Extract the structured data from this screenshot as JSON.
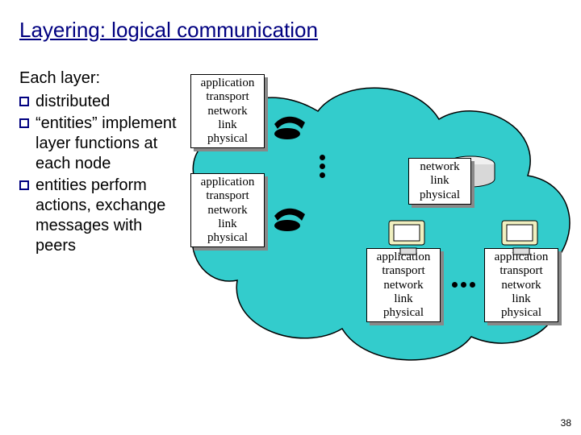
{
  "title": "Layering: logical communication",
  "left": {
    "heading": "Each layer:",
    "bullets": [
      "distributed",
      "“entities” implement layer functions at each node",
      "entities perform actions, exchange messages with peers"
    ]
  },
  "layers": {
    "full": [
      "application",
      "transport",
      "network",
      "link",
      "physical"
    ],
    "short": [
      "network",
      "link",
      "physical"
    ]
  },
  "page_number": "38",
  "icons": {
    "phone": "phone-icon",
    "disk": "disk-icon",
    "monitor": "monitor-icon",
    "cloud": "cloud-shape"
  }
}
